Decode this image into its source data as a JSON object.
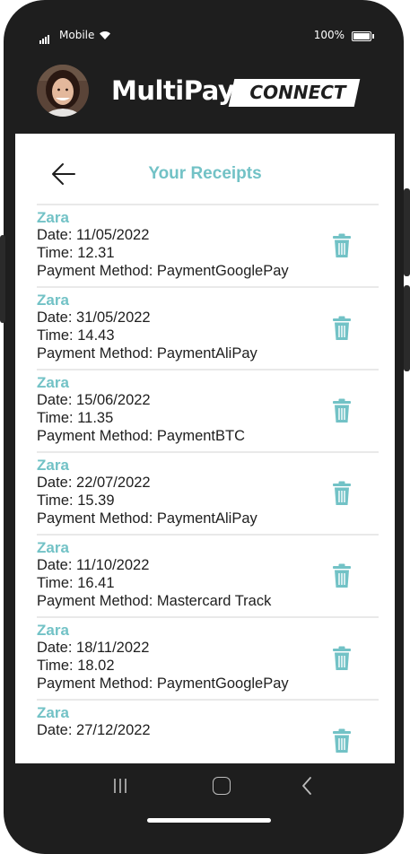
{
  "status_bar": {
    "carrier": "Mobile",
    "battery": "100%"
  },
  "brand": {
    "name": "MultiPay",
    "tagline": "CONNECT"
  },
  "page": {
    "title": "Your Receipts"
  },
  "receipts": [
    {
      "merchant": "Zara",
      "date": "Date: 11/05/2022",
      "time": "Time: 12.31",
      "method": "Payment Method: PaymentGooglePay"
    },
    {
      "merchant": "Zara",
      "date": "Date: 31/05/2022",
      "time": "Time: 14.43",
      "method": "Payment Method: PaymentAliPay"
    },
    {
      "merchant": "Zara",
      "date": "Date: 15/06/2022",
      "time": "Time: 11.35",
      "method": "Payment Method: PaymentBTC"
    },
    {
      "merchant": "Zara",
      "date": "Date: 22/07/2022",
      "time": "Time: 15.39",
      "method": "Payment Method: PaymentAliPay"
    },
    {
      "merchant": "Zara",
      "date": "Date: 11/10/2022",
      "time": "Time: 16.41",
      "method": "Payment Method: Mastercard Track"
    },
    {
      "merchant": "Zara",
      "date": "Date: 18/11/2022",
      "time": "Time: 18.02",
      "method": "Payment Method: PaymentGooglePay"
    },
    {
      "merchant": "Zara",
      "date": "Date: 27/12/2022"
    }
  ],
  "colors": {
    "accent": "#72c2c6",
    "frame": "#1e1e1e",
    "text": "#1e1e1e",
    "divider": "#e9e9e9"
  },
  "icons": {
    "back": "arrow-left-icon",
    "delete": "trash-icon",
    "nav_recent": "recent-apps-icon",
    "nav_home": "home-icon",
    "nav_back": "chevron-left-icon"
  }
}
